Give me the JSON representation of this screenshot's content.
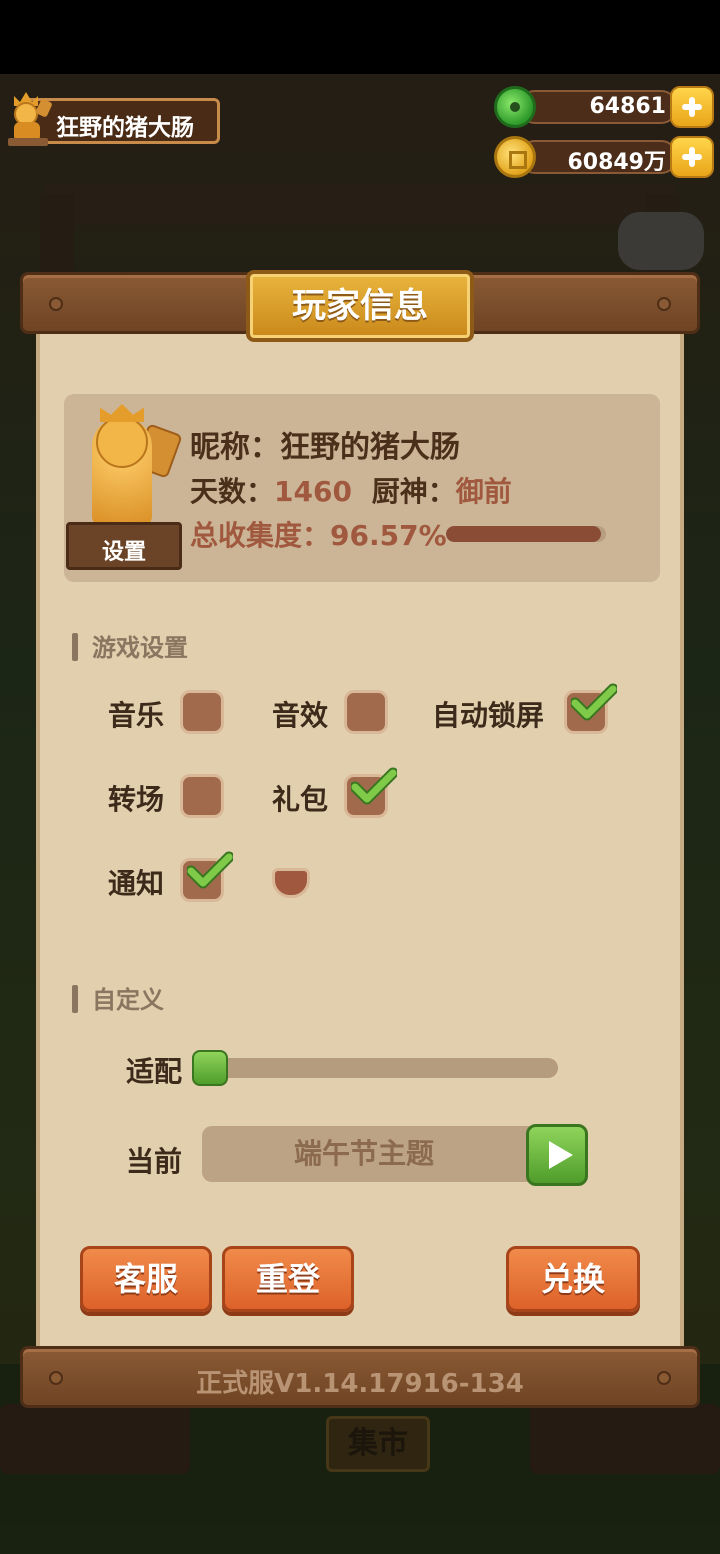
{
  "hud": {
    "player_name": "狂野的猪大肠",
    "jade": "64861",
    "gold": "60849万"
  },
  "background": {
    "market_label": "集市"
  },
  "panel": {
    "title": "玩家信息",
    "nickname_label": "昵称：",
    "nickname": "狂野的猪大肠",
    "days_label": "天数：",
    "days": "1460",
    "chef_label": "厨神：",
    "chef": "御前",
    "collection_label": "总收集度：",
    "collection": "96.57%",
    "collection_fraction": 0.9657,
    "settings_button": "设置",
    "game_settings_title": "游戏设置",
    "options": [
      {
        "label": "音乐",
        "checked": false
      },
      {
        "label": "音效",
        "checked": false
      },
      {
        "label": "自动锁屏",
        "checked": true
      },
      {
        "label": "转场",
        "checked": false
      },
      {
        "label": "礼包",
        "checked": true
      },
      {
        "label": "通知",
        "checked": true
      }
    ],
    "custom_title": "自定义",
    "adapt_label": "适配",
    "adapt_level": 0,
    "current_label": "当前",
    "current_theme": "端午节主题",
    "buttons": {
      "service": "客服",
      "relogin": "重登",
      "redeem": "兑换"
    },
    "version": "正式服V1.14.17916-134"
  },
  "colors": {
    "accent_orange": "#dd6229",
    "check_green": "#6cba3a",
    "panel_bg": "#e2cfae"
  }
}
